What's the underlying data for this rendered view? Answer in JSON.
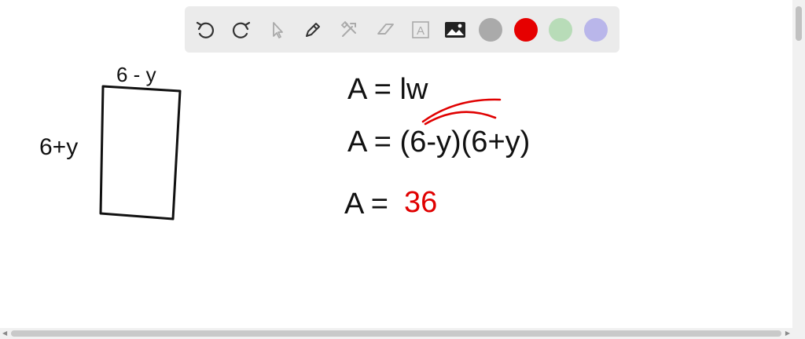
{
  "toolbar": {
    "tools": [
      {
        "name": "undo-icon"
      },
      {
        "name": "redo-icon"
      },
      {
        "name": "select-pointer-icon"
      },
      {
        "name": "pen-icon"
      },
      {
        "name": "tools-icon"
      },
      {
        "name": "eraser-icon"
      },
      {
        "name": "text-tool-icon",
        "label": "A"
      },
      {
        "name": "image-icon"
      }
    ],
    "colors": [
      "#aaaaaa",
      "#e60000",
      "#b8dcb8",
      "#b9b6ea"
    ]
  },
  "whiteboard": {
    "rect_top_label": "6 - y",
    "rect_left_label": "6+y",
    "eq1": "A = lw",
    "eq2": "A = (6-y)(6+y)",
    "eq3_prefix": "A =",
    "eq3_value": "36",
    "ink_color": "#111111",
    "highlight_color": "#e00000"
  }
}
